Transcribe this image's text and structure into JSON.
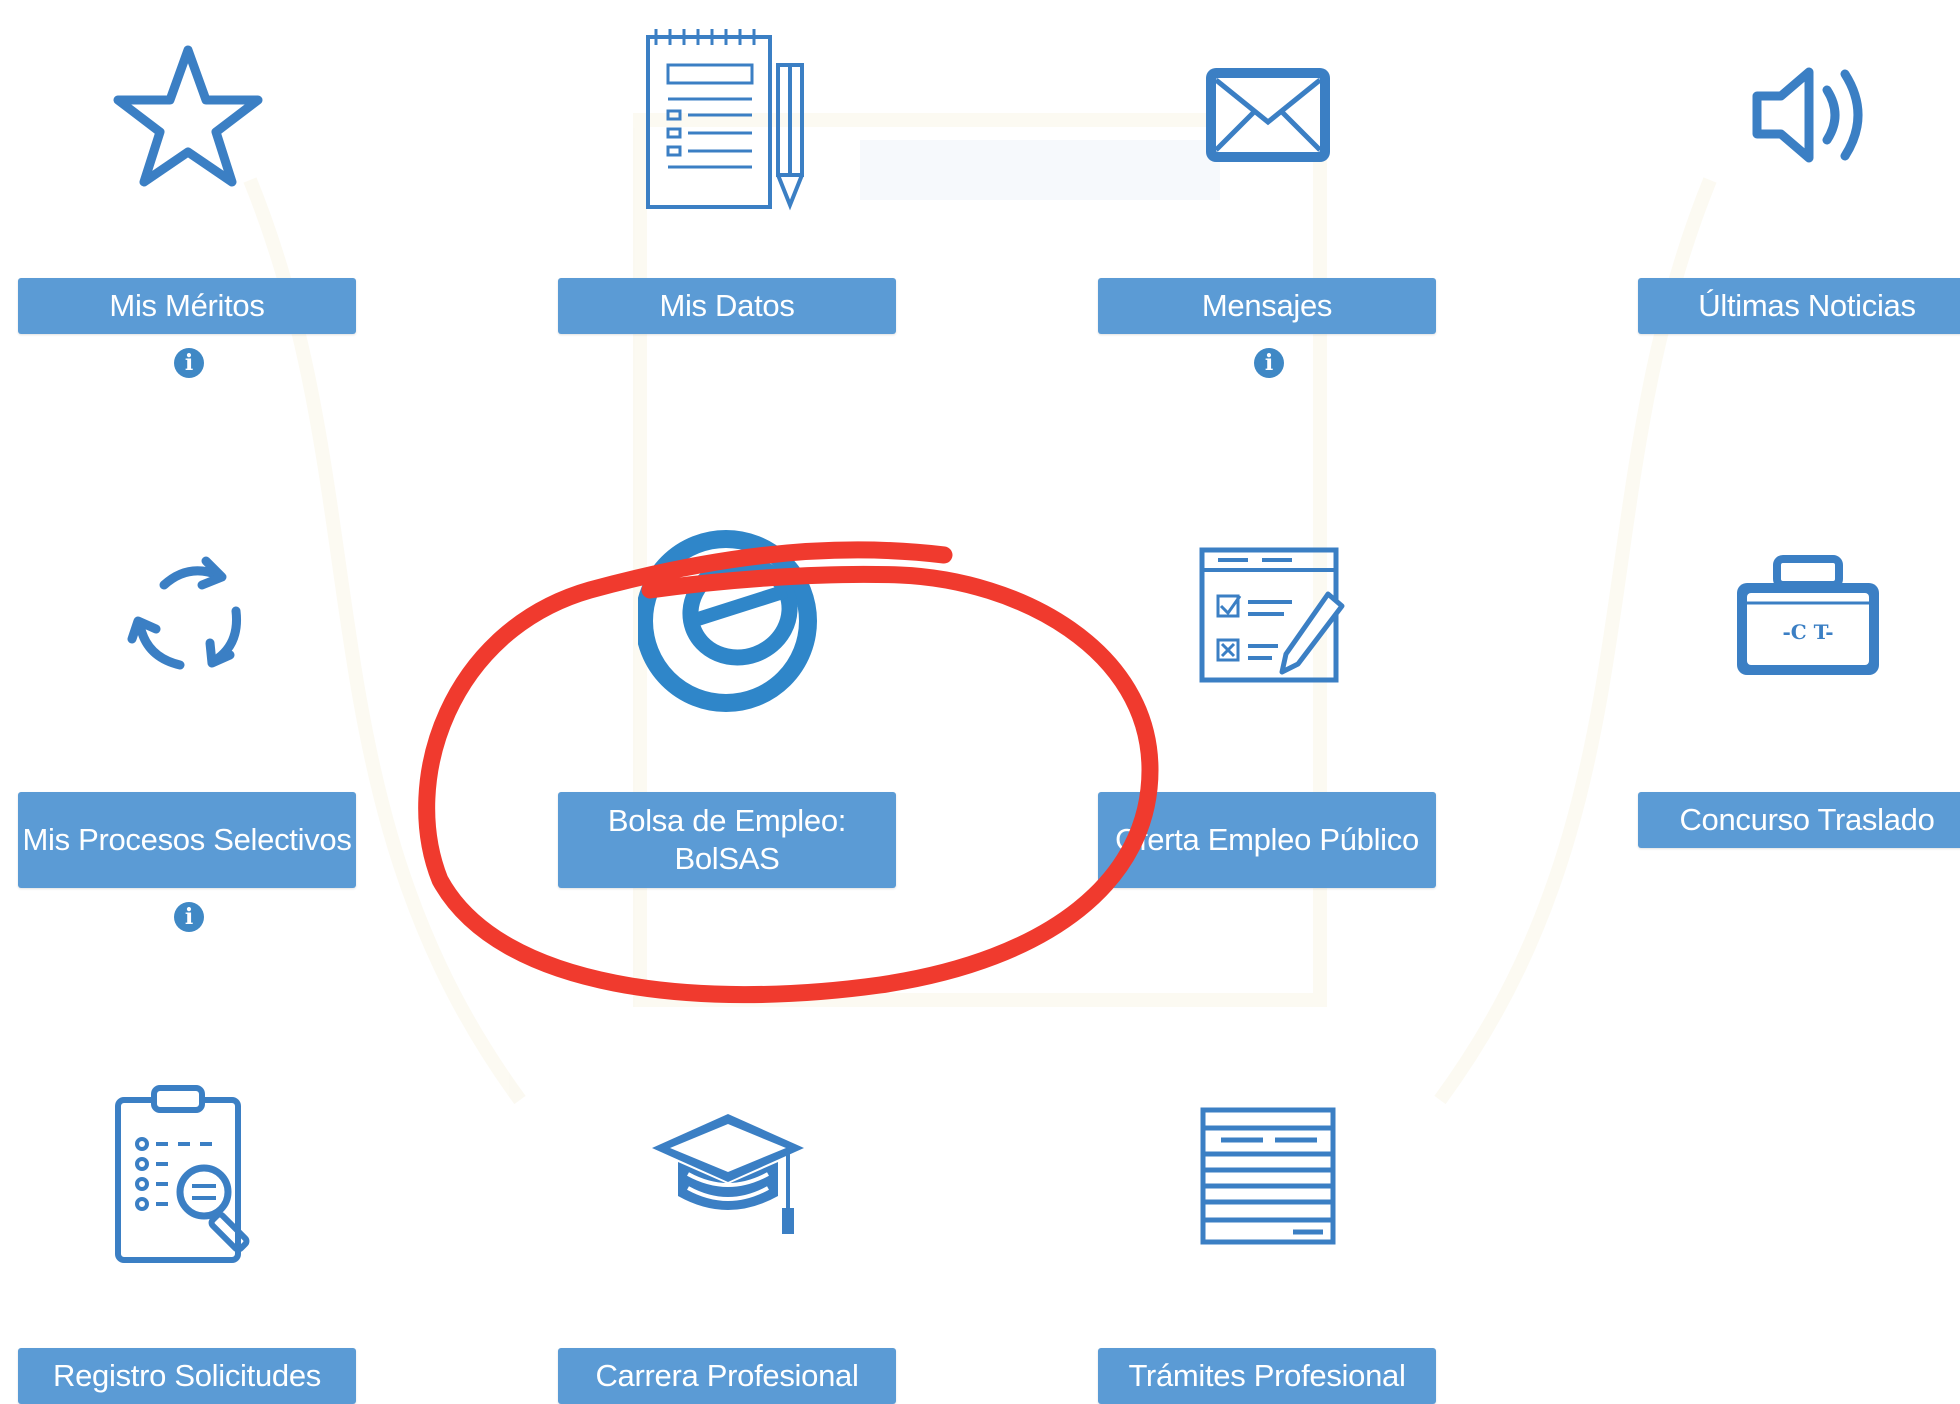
{
  "colors": {
    "accent": "#5b9bd5",
    "icon_stroke": "#3b7fc4",
    "info_badge": "#3f88c5",
    "annotation": "#f03a2e"
  },
  "tiles": [
    {
      "label": "Mis Méritos",
      "icon": "star-icon",
      "info": true
    },
    {
      "label": "Mis Datos",
      "icon": "notepad-icon",
      "info": false
    },
    {
      "label": "Mensajes",
      "icon": "envelope-icon",
      "info": true
    },
    {
      "label": "Últimas Noticias",
      "icon": "speaker-icon",
      "info": false
    },
    {
      "label": "Mis Procesos Selectivos",
      "icon": "recycle-icon",
      "info": true
    },
    {
      "label": "Bolsa de Empleo: BolSAS",
      "icon": "bolsas-logo-icon",
      "info": false,
      "highlighted": true
    },
    {
      "label": "Oferta Empleo Público",
      "icon": "form-checklist-icon",
      "info": false
    },
    {
      "label": "Concurso Traslado",
      "icon": "briefcase-icon",
      "info": false
    },
    {
      "label": "Registro Solicitudes",
      "icon": "clipboard-search-icon",
      "info": false
    },
    {
      "label": "Carrera Profesional",
      "icon": "graduation-cap-icon",
      "info": false
    },
    {
      "label": "Trámites Profesional",
      "icon": "document-lines-icon",
      "info": false
    }
  ],
  "info_glyph": "i"
}
